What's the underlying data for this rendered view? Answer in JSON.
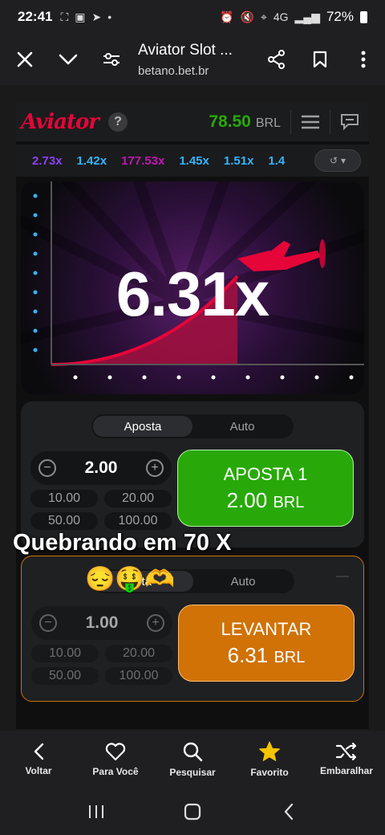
{
  "status_bar": {
    "time": "22:41",
    "network": "4G",
    "battery": "72%"
  },
  "browser": {
    "title": "Aviator Slot ...",
    "url": "betano.bet.br"
  },
  "game": {
    "logo": "Aviator",
    "help_label": "?",
    "balance_amount": "78.50",
    "balance_currency": "BRL",
    "history": [
      "2.73x",
      "1.42x",
      "177.53x",
      "1.45x",
      "1.51x",
      "1.4"
    ],
    "history_colors": [
      "#913ef8",
      "#34b4ff",
      "#c017b4",
      "#34b4ff",
      "#34b4ff",
      "#34b4ff"
    ],
    "multiplier": "6.31x",
    "accent_red": "#e50539",
    "bet_panel_1": {
      "tab_bet": "Aposta",
      "tab_auto": "Auto",
      "amount": "2.00",
      "quick": [
        "10.00",
        "20.00",
        "50.00",
        "100.00"
      ],
      "action_line1": "APOSTA 1",
      "action_value": "2.00",
      "action_currency": "BRL",
      "action_color": "#28a909"
    },
    "bet_panel_2": {
      "tab_bet": "sta",
      "tab_auto": "Auto",
      "amount": "1.00",
      "quick": [
        "10.00",
        "20.00",
        "50.00",
        "100.00"
      ],
      "action_line1": "LEVANTAR",
      "action_value": "6.31",
      "action_currency": "BRL",
      "action_color": "#d07206"
    }
  },
  "overlay": {
    "caption": "Quebrando em 70 X",
    "emojis": "😔🤑🫶"
  },
  "bottom_nav": [
    {
      "label": "Voltar",
      "icon": "chevron-left-icon"
    },
    {
      "label": "Para Você",
      "icon": "heart-icon"
    },
    {
      "label": "Pesquisar",
      "icon": "search-icon"
    },
    {
      "label": "Favorito",
      "icon": "star-icon"
    },
    {
      "label": "Embaralhar",
      "icon": "shuffle-icon"
    }
  ]
}
